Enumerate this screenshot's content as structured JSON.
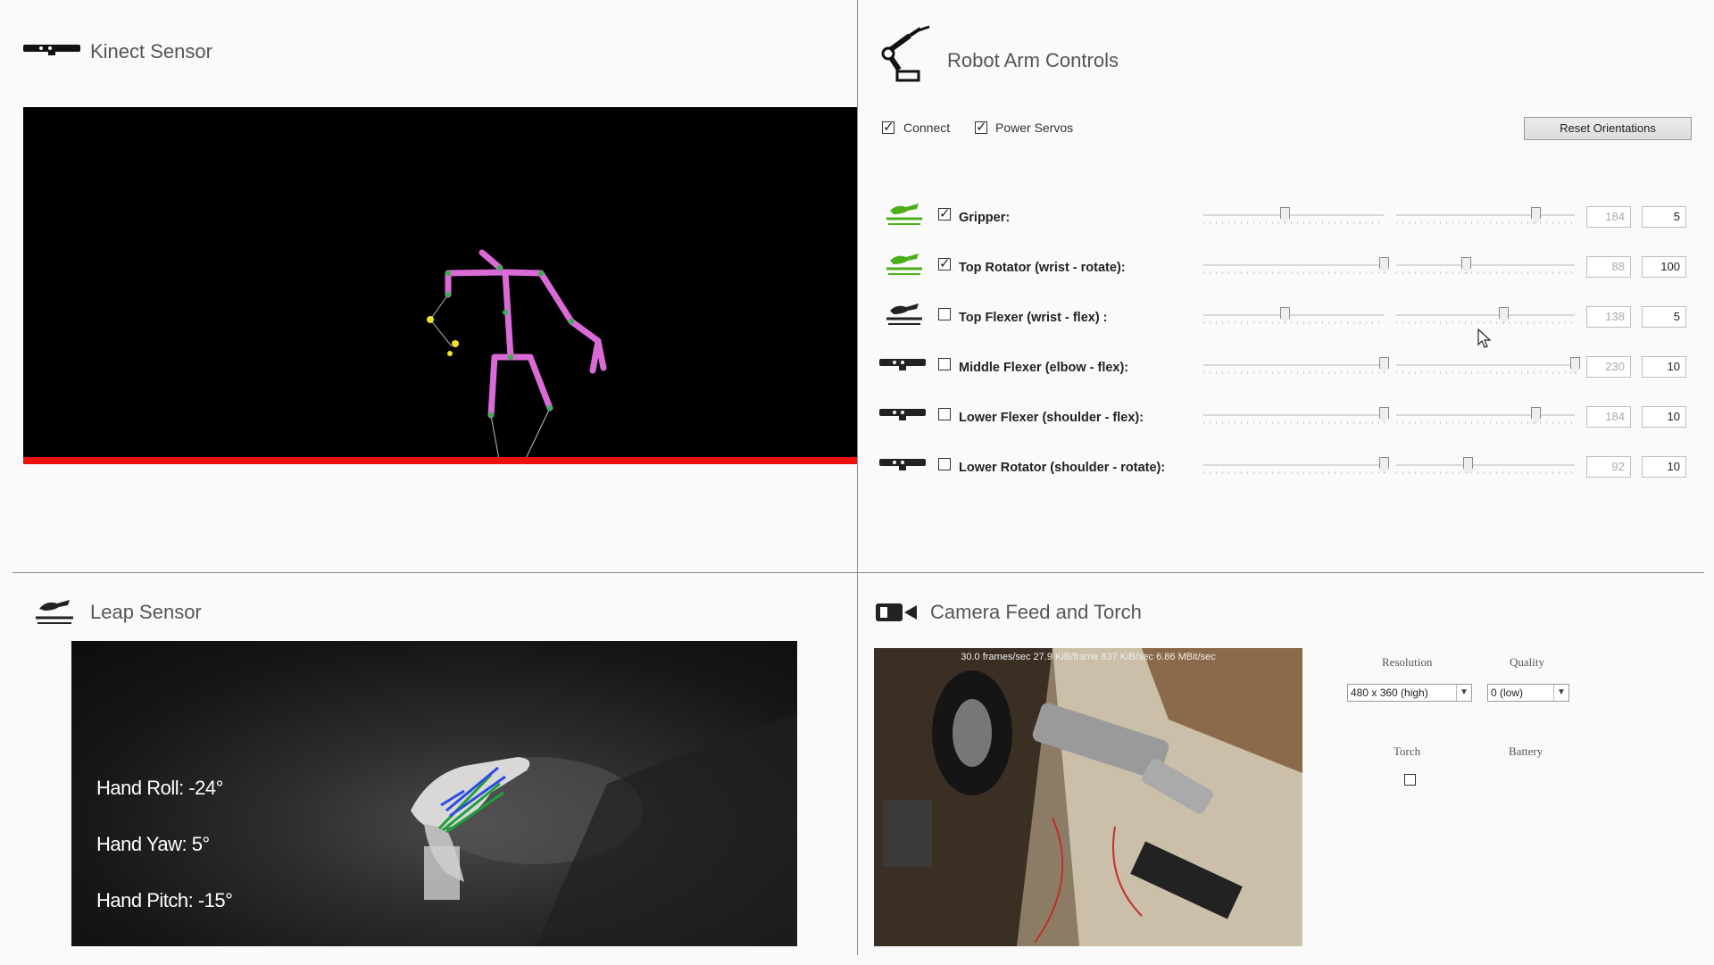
{
  "kinect": {
    "title": "Kinect Sensor",
    "icon": "kinect-sensor-icon"
  },
  "robot": {
    "title": "Robot Arm Controls",
    "icon": "robot-arm-icon",
    "connect_label": "Connect",
    "connect_checked": true,
    "power_label": "Power Servos",
    "power_checked": true,
    "reset_label": "Reset Orientations",
    "joints": [
      {
        "label": "Gripper:",
        "icon": "leap-hand-icon",
        "icon_color": "#4caf1a",
        "checked": true,
        "value": "184",
        "speed": "5",
        "pos_fraction": 0.45,
        "speed_fraction": 0.78
      },
      {
        "label": "Top Rotator (wrist - rotate):",
        "icon": "leap-hand-icon",
        "icon_color": "#4caf1a",
        "checked": true,
        "value": "88",
        "speed": "100",
        "pos_fraction": 1.0,
        "speed_fraction": 0.39
      },
      {
        "label": "Top Flexer (wrist - flex) :",
        "icon": "leap-hand-icon",
        "icon_color": "#222222",
        "checked": false,
        "value": "138",
        "speed": "5",
        "pos_fraction": 0.45,
        "speed_fraction": 0.6
      },
      {
        "label": "Middle Flexer (elbow - flex):",
        "icon": "kinect-sensor-icon",
        "icon_color": "#222222",
        "checked": false,
        "value": "230",
        "speed": "10",
        "pos_fraction": 1.0,
        "speed_fraction": 1.0
      },
      {
        "label": "Lower Flexer (shoulder - flex):",
        "icon": "kinect-sensor-icon",
        "icon_color": "#222222",
        "checked": false,
        "value": "184",
        "speed": "10",
        "pos_fraction": 1.0,
        "speed_fraction": 0.78
      },
      {
        "label": "Lower Rotator (shoulder - rotate):",
        "icon": "kinect-sensor-icon",
        "icon_color": "#222222",
        "checked": false,
        "value": "92",
        "speed": "10",
        "pos_fraction": 1.0,
        "speed_fraction": 0.4
      }
    ]
  },
  "leap": {
    "title": "Leap Sensor",
    "icon": "leap-hand-icon",
    "hand_roll": "Hand Roll: -24°",
    "hand_yaw": "Hand Yaw: 5°",
    "hand_pitch": "Hand Pitch: -15°"
  },
  "camera": {
    "title": "Camera Feed and Torch",
    "icon": "video-camera-icon",
    "stats": "30.0 frames/sec   27.9 KiB/frame   837 KiB/sec   6.86 MBit/sec",
    "resolution_label": "Resolution",
    "resolution_value": "480 x 360 (high)",
    "quality_label": "Quality",
    "quality_value": "0 (low)",
    "torch_label": "Torch",
    "torch_checked": false,
    "battery_label": "Battery"
  }
}
